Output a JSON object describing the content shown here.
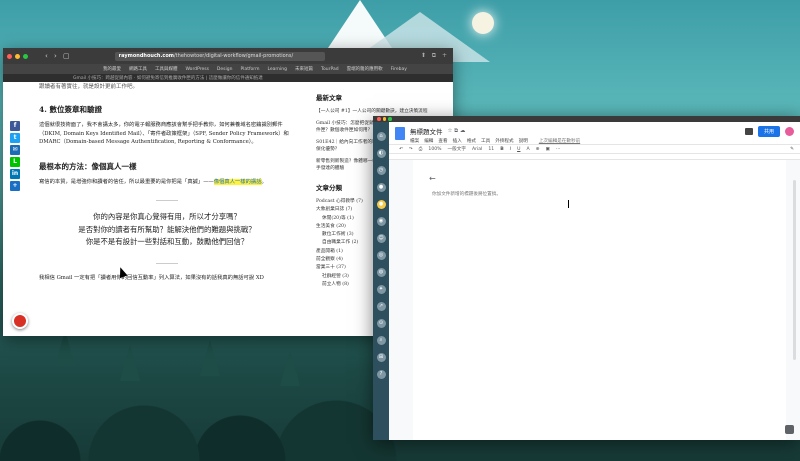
{
  "browser1": {
    "nav_glyphs": "‹ › ▢",
    "url_domain": "raymondhouch.com",
    "url_path": "/thehowtoer/digital-workflow/gmail-promotions/",
    "toolbar_glyphs": "⬆ ⧉ +",
    "bookmarks": [
      "我的最愛",
      "網路工具",
      "工具與媒體",
      "WordPress",
      "Design",
      "Platform",
      "Learning",
      "未來短篇",
      "TourPad",
      "雲端的雜的應用軟",
      "Firebay"
    ],
    "tab_text": "Gmail 小技巧：跨越促銷內容 · 如何避免寄信到推廣收件匣的方法 | 這麼做讓你的信件通知抵達",
    "page": {
      "cut_text": "跟讀者有著實往，就是設計更前工作吧。",
      "heading1": "4. 數位簽章和驗證",
      "para1": "這個就很技術面了，我不會講太多，你的電子報服務商應該會幫手把手教你，如何兼養域名密鑰識別郵件（DKIM, Domain Keys Identified Mail）、「寄件者政策框架」（SPF, Sender Policy Framework）和 DMARC（Domain-based Message Authentification, Reporting & Conformance）。",
      "heading2": "最根本的方法：像個真人一樣",
      "para2_before": "寫信的本質，是增強你和讀者的信任，所以最重要的是你把是「真誠」——",
      "para2_highlight": "像個真人一樣的講話",
      "para2_after": "。",
      "quote_lines": [
        "你的內容是你真心覺得有用，所以才分享嗎？",
        "是否對你的讀者有所幫助？能解決他們的難題與挑戰？",
        "你是不是有設計一些對話和互動，鼓勵他們回信？"
      ],
      "para3": "我相信 Gmail 一定有把「讀者用你的回信互動率」列入算法，如果沒有的話我真的無話可說 XD"
    },
    "sidebar": {
      "latest_title": "最新文章",
      "latest": [
        "【一人公司 #1】一人公司的關鍵數訣，建立決策流程",
        "Gmail 小技巧：怎麼把促銷內容移到推廣收件匣？動作重要收件匣？數個收件匣如何用？",
        "S01E42｜給內向工作者的職涯指南：不同性格的人應該怎麼保化優勢？",
        "新零售到新製造？像體哪一模品牌專心，創業家們從零到整至手發達的體驗"
      ],
      "cat_title": "文章分類",
      "categories": [
        {
          "label": "Podcast 心得教學 (7)",
          "sub": false
        },
        {
          "label": "大象創業日誌 (7)",
          "sub": false
        },
        {
          "label": "休閒(20)等 (1)",
          "sub": true
        },
        {
          "label": "生活美食 (20)",
          "sub": false
        },
        {
          "label": "數位工作術 (3)",
          "sub": true
        },
        {
          "label": "自由職業工作 (2)",
          "sub": true
        },
        {
          "label": "產品開箱 (1)",
          "sub": false
        },
        {
          "label": "前全觀察 (4)",
          "sub": false
        },
        {
          "label": "當業三十 (37)",
          "sub": false
        },
        {
          "label": "社群經營 (3)",
          "sub": true
        },
        {
          "label": "前立人物 (8)",
          "sub": true
        }
      ]
    }
  },
  "share_icons": [
    {
      "label": "f",
      "color": "#3b5998"
    },
    {
      "label": "t",
      "color": "#1da1f2"
    },
    {
      "label": "✉",
      "color": "#1c6cb5"
    },
    {
      "label": "L",
      "color": "#00c300"
    },
    {
      "label": "in",
      "color": "#0077b5"
    },
    {
      "label": "+",
      "color": "#1a6fc4"
    }
  ],
  "docs": {
    "title": "無標題文件",
    "title_icons": "☆ ⧉ ☁",
    "menu": [
      "檔案",
      "編輯",
      "查看",
      "插入",
      "格式",
      "工具",
      "外掛程式",
      "說明"
    ],
    "last_edit": "上次編輯是在數秒前",
    "share_label": "共用",
    "toolbar": {
      "undo": "↶",
      "redo": "↷",
      "print": "⎙",
      "zoom": "100%",
      "style": "一般文字",
      "font": "Arial",
      "size": "11",
      "bold": "B",
      "italic": "I",
      "underline": "U",
      "color": "A",
      "link": "⊕",
      "image": "▣",
      "more": "⋯",
      "pen": "✎"
    },
    "back_arrow": "←",
    "placeholder": "你加文件新增的標題後將位置搞。"
  },
  "rail_icons": [
    "⌂",
    "◐",
    "◷",
    "●",
    "●",
    "◉",
    "☺",
    "◎",
    "◍",
    "✦",
    "↗",
    "⊙",
    "⌕",
    "⊞",
    "?"
  ]
}
